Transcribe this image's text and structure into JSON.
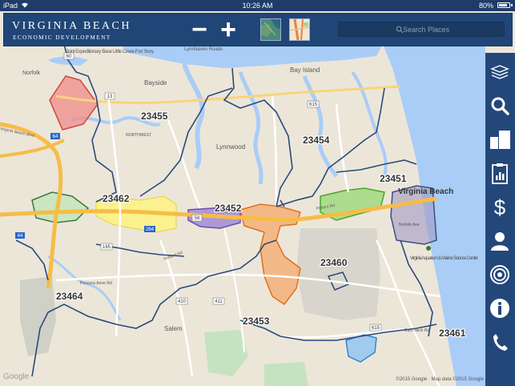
{
  "status_bar": {
    "carrier": "iPad",
    "time": "10:26 AM",
    "battery": "80%",
    "battery_level": 0.8
  },
  "header": {
    "brand_title": "VIRGINIA BEACH",
    "brand_subtitle": "ECONOMIC DEVELOPMENT",
    "zoom_out_label": "−",
    "zoom_in_label": "+",
    "search_placeholder": "Search Places"
  },
  "toolbar": {
    "items": [
      {
        "name": "layers-icon"
      },
      {
        "name": "search-icon"
      },
      {
        "name": "buildings-icon"
      },
      {
        "name": "report-icon"
      },
      {
        "name": "dollar-icon"
      },
      {
        "name": "person-icon"
      },
      {
        "name": "target-icon"
      },
      {
        "name": "info-icon"
      },
      {
        "name": "phone-icon"
      }
    ]
  },
  "map": {
    "zip_codes": [
      "23455",
      "23454",
      "23451",
      "23462",
      "23452",
      "23460",
      "23464",
      "23453",
      "23461"
    ],
    "city_label": "Virginia Beach",
    "places": [
      "Bay Island",
      "Bayside",
      "Lynnwood",
      "Norfolk",
      "Salem",
      "Virginia Aquarium & Marine Science Center",
      "Joint Expeditionary Base Little Creek-Fort Story",
      "Lynnhaven Roads",
      "NORTHWEST"
    ],
    "roads": [
      "Virginia Beach Blvd",
      "Potters Rd",
      "Norfolk Ave",
      "Dam Neck Rd",
      "Princess Anne Rd",
      "Holland Rd"
    ],
    "route_shields": [
      "60",
      "13",
      "64",
      "264",
      "58",
      "615",
      "165",
      "410",
      "411",
      "44",
      "407",
      "615"
    ],
    "colors": {
      "water": "#a9cdf7",
      "land": "#ece6d9",
      "zip_boundary": "#2a4a7a",
      "highway": "#f6bd45",
      "district_red": "#f08b89",
      "district_yellow": "#fff47a",
      "district_purple": "#9a7ed4",
      "district_orange": "#f6a86b",
      "district_green": "#9ed97a",
      "district_blue": "#8ec4f2"
    }
  },
  "footer": {
    "google": "Google",
    "attribution": "©2015 Google · Map data ©2015 Google"
  }
}
